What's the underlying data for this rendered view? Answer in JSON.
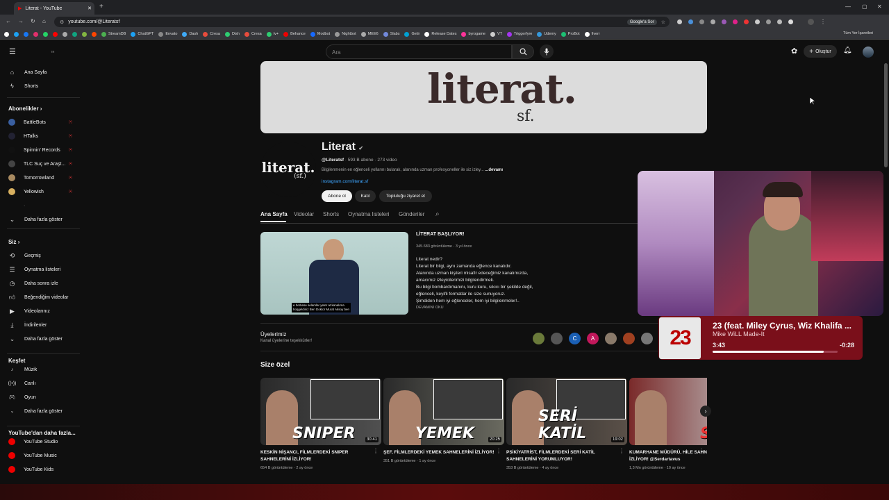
{
  "browser": {
    "tab_title": "Literat - YouTube",
    "url": "youtube.com/@Literatsf",
    "google_lens": "Google'a Sor",
    "bookmarks": [
      "StreamDB",
      "ChatGPT",
      "Envato",
      "Dash",
      "Cresa",
      "Dish",
      "Cresa",
      "tv+",
      "Behance",
      "Modbot",
      "Nightbot",
      "MEE6",
      "Slabs",
      "Getir",
      "Release Dates",
      "byrogame",
      "VT",
      "Triggerfyre",
      "Udemy",
      "ProBot",
      "fiverr"
    ],
    "all_bookmarks": "Tüm Yer İşaretleri"
  },
  "yt": {
    "logo_region": "TR",
    "search_placeholder": "Ara",
    "create_label": "Oluştur"
  },
  "sidebar": {
    "home": "Ana Sayfa",
    "shorts": "Shorts",
    "subs_header": "Abonelikler",
    "subs": [
      {
        "label": "BattleBots",
        "color": "#3a5fa0"
      },
      {
        "label": "HTalks",
        "color": "#223"
      },
      {
        "label": "Spinnin' Records",
        "color": "#111"
      },
      {
        "label": "TLC Suç ve Araşt...",
        "color": "#444"
      },
      {
        "label": "Tomorrowland",
        "color": "#a88a60"
      },
      {
        "label": "Yellowish",
        "color": "#d8b060"
      }
    ],
    "show_more": "Daha fazla göster",
    "you_header": "Siz",
    "you_items": [
      "Geçmiş",
      "Oynatma listeleri",
      "Daha sonra izle",
      "Beğendiğim videolar",
      "Videolarınız",
      "İndirilenler",
      "Daha fazla göster"
    ],
    "explore_header": "Keşfet",
    "explore_items": [
      "Müzik",
      "Canlı",
      "Oyun",
      "Daha fazla göster"
    ],
    "more_header": "YouTube'dan daha fazla...",
    "more_items": [
      "YouTube Studio",
      "YouTube Music",
      "YouTube Kids"
    ]
  },
  "channel": {
    "banner_word": "literat.",
    "banner_sf": "sf.",
    "avatar_word": "literat.",
    "avatar_sf": "(sf.)",
    "name": "Literat",
    "handle": "@Literatsf",
    "stats": "· 593 B abone · 273 video",
    "description": "Bilgilenmenin en eğlenceli yollarını bularak, alanında uzman profesyoneller ile siz izley...",
    "more": "...devamı",
    "link": "instagram.com/literat.sf",
    "subscribe": "Abone ol",
    "join": "Katıl",
    "community": "Topluluğu ziyaret et",
    "tabs": [
      "Ana Sayfa",
      "Videolar",
      "Shorts",
      "Oynatma listeleri",
      "Gönderiler"
    ]
  },
  "featured": {
    "title": "LİTERAT BAŞLIYOR!",
    "meta": "345.683 görüntüleme · 3 yıl önce",
    "desc": [
      "Literat nedir?",
      "Literat bir bilgi, aynı zamanda eğlence kanalıdır.",
      "Alanında uzman kişileri misafir edeceğimiz kanalımızda,",
      "amacımız izleyicilerimizi bilgilendirmek.",
      "Bu bilgi bombardımanını, kuru kuru, sıkıcı bir şekilde değil,",
      "eğlenceli, keyifli formatlar ile size sunuyoruz.",
      "Şimdiden hem iyi eğlenceler, hem iyi bilgilenmeler!.."
    ],
    "read_more": "DEVAMINI OKU",
    "caption1": "e herkese selamlar yeter at kanalıma",
    "caption2": "hoşgeldiniz Ben Doktor Murat Aksoy ben"
  },
  "members": {
    "title": "Üyelerimiz",
    "subtitle": "Kanal üyelerine teşekkürler!",
    "avatars": [
      {
        "letter": "",
        "color": "#6a7a3a"
      },
      {
        "letter": "",
        "color": "#555"
      },
      {
        "letter": "C",
        "color": "#1a5fb4"
      },
      {
        "letter": "A",
        "color": "#c2185b"
      },
      {
        "letter": "",
        "color": "#8a7a6a"
      },
      {
        "letter": "",
        "color": "#a04020"
      },
      {
        "letter": "",
        "color": "#777"
      }
    ]
  },
  "for_you": {
    "title": "Size özel",
    "videos": [
      {
        "title": "KESKİN NİŞANCI, FİLMLERDEKİ SNIPER SAHNELERİNİ İZLİYOR!",
        "meta": "654 B görüntüleme · 2 ay önce",
        "duration": "30:41",
        "word": "SNIPER"
      },
      {
        "title": "ŞEF, FİLMLERDEKİ YEMEK SAHNELERİNİ İZLİYOR!",
        "meta": "351 B görüntüleme · 1 ay önce",
        "duration": "20:25",
        "word": "YEMEK"
      },
      {
        "title": "PSİKİYATRİST, FİLMLERDEKİ SERİ KATİL SAHNELERİNİ YORUMLUYOR!",
        "meta": "353 B görüntüleme · 4 ay önce",
        "duration": "19:02",
        "word": "SERİ KATİL"
      },
      {
        "title": "KUMARHANE MÜDÜRÜ, HİLE SAHNELERİNİ İZLİYOR! @Serdartavus",
        "meta": "1,3 Mn görüntüleme · 10 ay önce",
        "duration": "",
        "word": "S"
      }
    ]
  },
  "music": {
    "cover_number": "23",
    "title": "23 (feat. Miley Cyrus, Wiz Khalifa ...",
    "artist": "Mike WiLL Made-It",
    "elapsed": "3:43",
    "remaining": "-0:28",
    "progress": 0.89
  }
}
